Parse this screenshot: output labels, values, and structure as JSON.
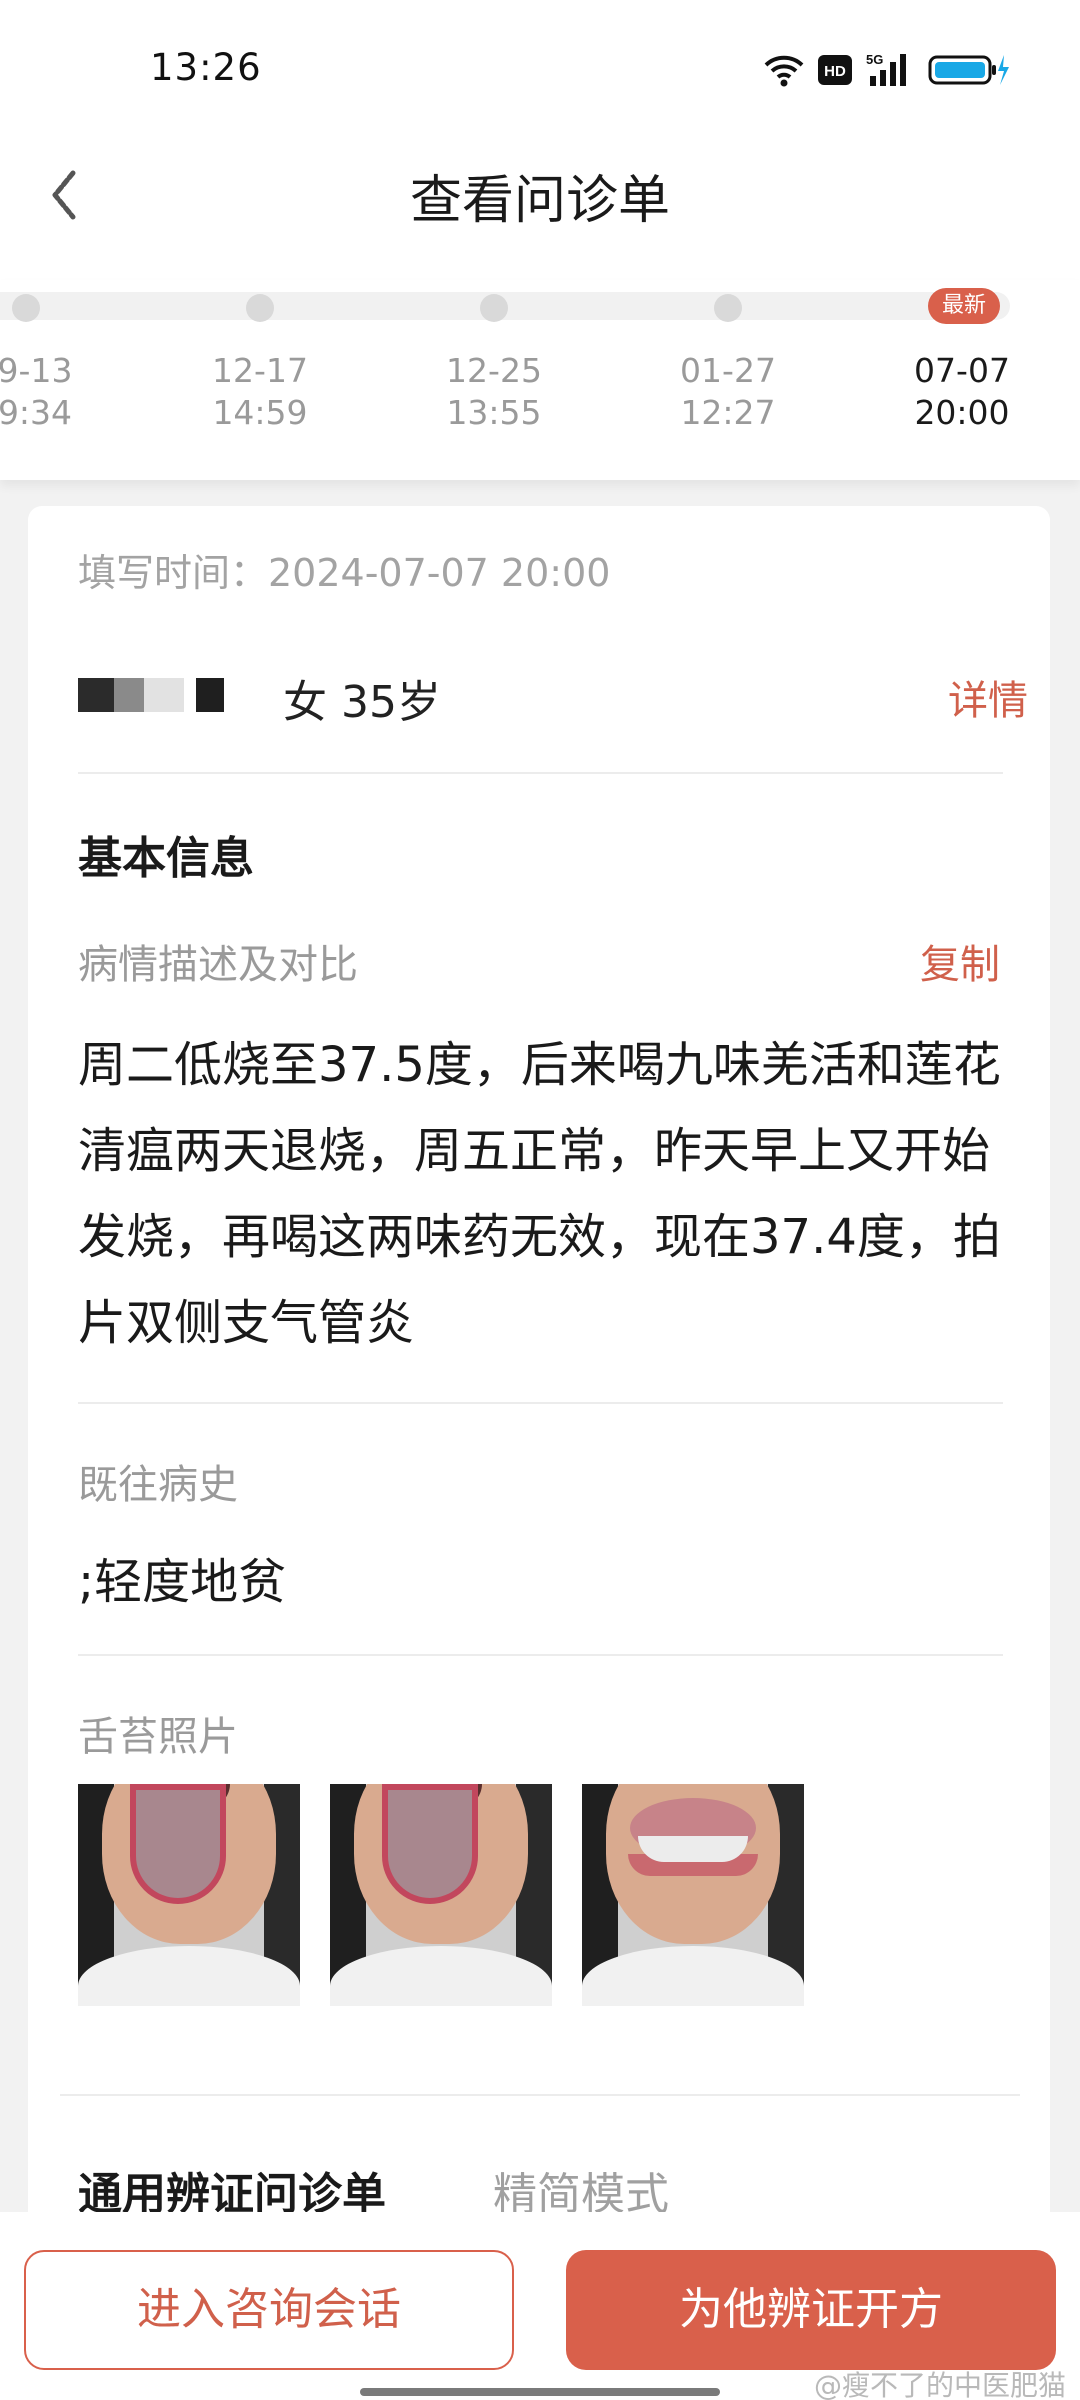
{
  "status_bar": {
    "time": "13:26",
    "hd_label": "HD",
    "network_label": "5G"
  },
  "header": {
    "title": "查看问诊单"
  },
  "timeline": {
    "badge": "最新",
    "entries": [
      {
        "date": "9-13",
        "time": "9:34",
        "active": false
      },
      {
        "date": "12-17",
        "time": "14:59",
        "active": false
      },
      {
        "date": "12-25",
        "time": "13:55",
        "active": false
      },
      {
        "date": "01-27",
        "time": "12:27",
        "active": false
      },
      {
        "date": "07-07",
        "time": "20:00",
        "active": true
      }
    ]
  },
  "record": {
    "fill_time": "填写时间：2024-07-07 20:00",
    "patient_info": "女 35岁",
    "detail_label": "详情",
    "basic_info_title": "基本信息",
    "description_label": "病情描述及对比",
    "copy_label": "复制",
    "description_text": "周二低烧至37.5度，后来喝九味羌活和莲花清瘟两天退烧，周五正常，昨天早上又开始发烧，再喝这两味药无效，现在37.4度，拍片双侧支气管炎",
    "history_label": "既往病史",
    "history_text": ";轻度地贫",
    "tongue_photos_label": "舌苔照片",
    "tab_active": "通用辨证问诊单",
    "tab_inactive": "精简模式"
  },
  "bottom": {
    "consult_button": "进入咨询会话",
    "prescribe_button": "为他辨证开方",
    "watermark": "@瘦不了的中医肥猫"
  },
  "colors": {
    "accent": "#d9604b",
    "accent_text": "#d0604b",
    "muted_text": "#9a9a9a",
    "background": "#f2f2f2"
  }
}
